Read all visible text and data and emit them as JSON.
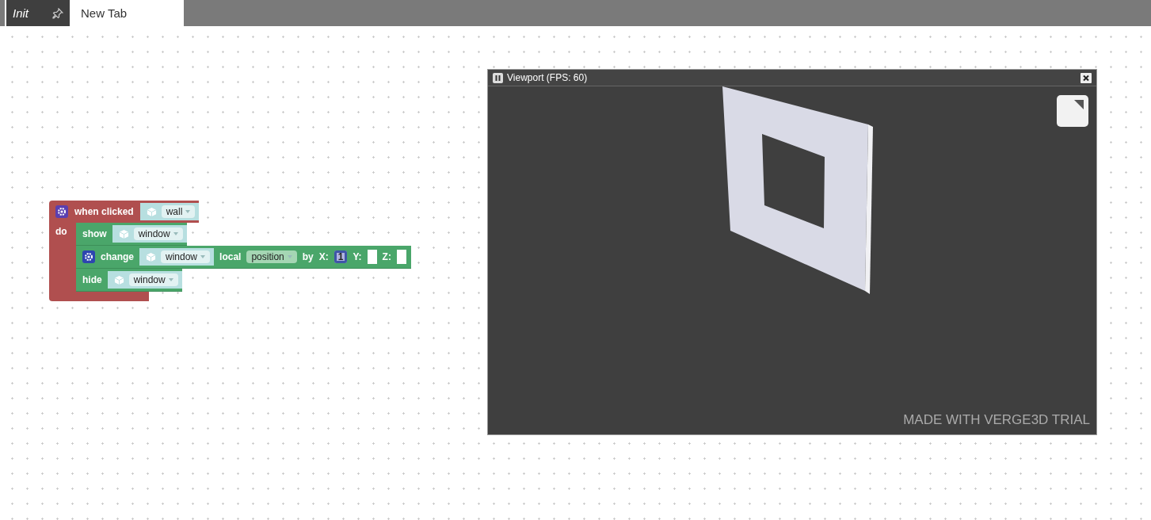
{
  "tabs": [
    {
      "label": "Init",
      "selected": true,
      "pinned": true
    },
    {
      "label": "New Tab",
      "selected": false,
      "pinned": false
    }
  ],
  "event_block": {
    "label": "when clicked",
    "object": "wall",
    "do_label": "do",
    "statements": [
      {
        "kind": "show",
        "label": "show",
        "object": "window"
      },
      {
        "kind": "change",
        "label": "change",
        "object": "window",
        "space": "local",
        "property": "position",
        "by": "by",
        "x_label": "X:",
        "x_value": "1",
        "y_label": "Y:",
        "z_label": "Z:"
      },
      {
        "kind": "hide",
        "label": "hide",
        "object": "window"
      }
    ]
  },
  "viewport": {
    "title": "Viewport (FPS: 60)",
    "trial_notice": "MADE WITH VERGE3D TRIAL"
  }
}
